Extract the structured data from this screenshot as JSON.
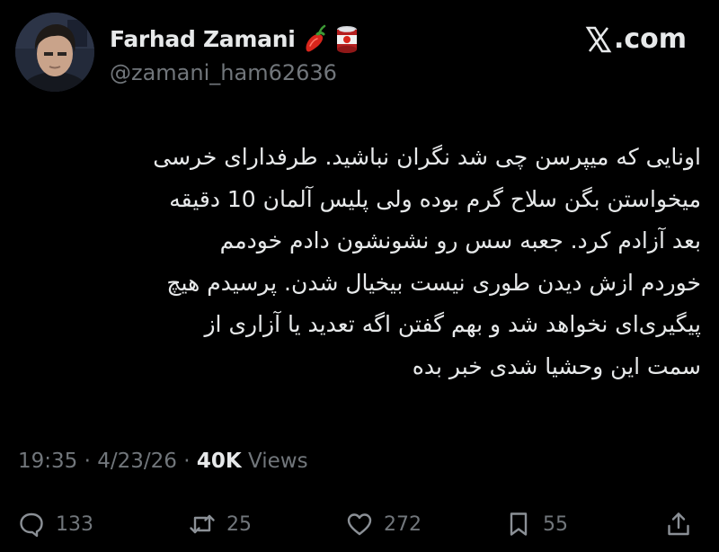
{
  "author": {
    "display_name": "Farhad Zamani",
    "handle": "@zamani_ham62636",
    "name_emojis": [
      "hot-pepper-emoji",
      "canned-food-emoji"
    ]
  },
  "brand": {
    "domain": ".com",
    "logo_icon": "x-logo-icon"
  },
  "tweet": {
    "text": "اونایی که میپرسن چی شد نگران نباشید. طرفدارای خرسی میخواستن بگن سلاح گرم بوده ولی پلیس آلمان 10 دقیقه بعد آزادم کرد. جعبه سس رو نشونشون دادم خودمم خوردم ازش دیدن طوری نیست بیخیال شدن. پرسیدم هیچ پیگیری‌ای نخواهد شد و بهم گفتن اگه تعدید یا آزاری از سمت این وحشیا شدی خبر بده",
    "lines": [
      "اونایی که میپرسن چی شد نگران نباشید. طرفدارای خرسی",
      "میخواستن بگن سلاح گرم بوده ولی پلیس آلمان 10 دقیقه",
      "بعد آزادم کرد. جعبه سس رو نشونشون دادم خودمم",
      "خوردم ازش دیدن طوری نیست بیخیال شدن. پرسیدم هیچ",
      "پیگیری‌ای نخواهد شد و بهم گفتن اگه تعدید یا آزاری از",
      "سمت این وحشیا شدی خبر بده"
    ]
  },
  "meta": {
    "time": "19:35",
    "separator": "·",
    "date": "4/23/26",
    "views_count": "40K",
    "views_label": "Views"
  },
  "actions": {
    "replies": "133",
    "reposts": "25",
    "likes": "272",
    "bookmarks": "55"
  },
  "colors": {
    "background": "#000000",
    "text_primary": "#e7e9ea",
    "text_secondary": "#71767b"
  }
}
